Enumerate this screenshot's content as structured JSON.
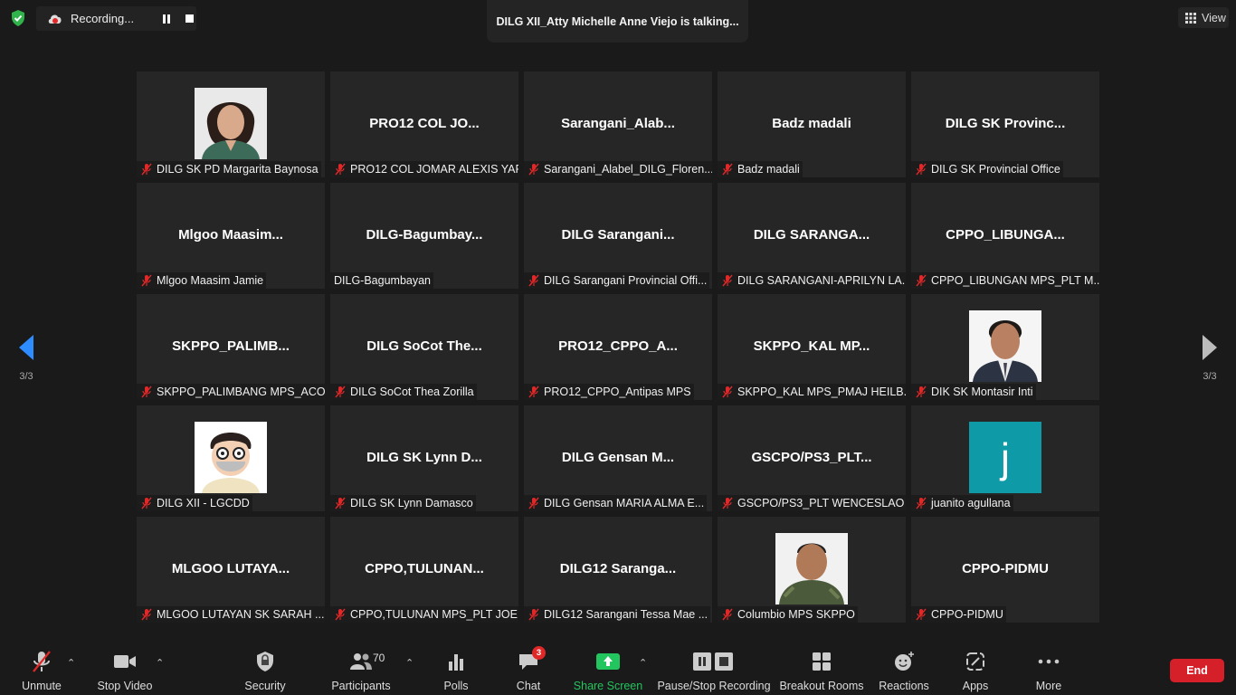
{
  "recording": {
    "label": "Recording..."
  },
  "speaker": {
    "text": "DILG XII_Atty Michelle Anne Viejo is talking..."
  },
  "view": {
    "label": "View"
  },
  "pages": {
    "left": "3/3",
    "right": "3/3"
  },
  "colors": {
    "share_green": "#22c55e",
    "end_red": "#d5202a",
    "mute_red": "#e02828",
    "tile_bg": "#262626"
  },
  "tiles": [
    {
      "big": "",
      "label": "DILG SK PD Margarita Baynosa",
      "muted": true,
      "avatar": "photo-woman"
    },
    {
      "big": "PRO12 COL JO...",
      "label": "PRO12 COL JOMAR ALEXIS YAP",
      "muted": true
    },
    {
      "big": "Sarangani_Alab...",
      "label": "Sarangani_Alabel_DILG_Floren...",
      "muted": true
    },
    {
      "big": "Badz madali",
      "label": "Badz madali",
      "muted": true
    },
    {
      "big": "DILG SK Provinc...",
      "label": "DILG SK Provincial Office",
      "muted": true
    },
    {
      "big": "Mlgoo Maasim...",
      "label": "Mlgoo Maasim Jamie",
      "muted": true
    },
    {
      "big": "DILG-Bagumbay...",
      "label": "DILG-Bagumbayan",
      "muted": false
    },
    {
      "big": "DILG Sarangani...",
      "label": "DILG Sarangani Provincial Offi...",
      "muted": true
    },
    {
      "big": "DILG SARANGA...",
      "label": "DILG SARANGANI-APRILYN LA...",
      "muted": true
    },
    {
      "big": "CPPO_LIBUNGA...",
      "label": "CPPO_LIBUNGAN MPS_PLT M...",
      "muted": true
    },
    {
      "big": "SKPPO_PALIMB...",
      "label": "SKPPO_PALIMBANG MPS_ACO...",
      "muted": true
    },
    {
      "big": "DILG SoCot The...",
      "label": "DILG SoCot Thea Zorilla",
      "muted": true
    },
    {
      "big": "PRO12_CPPO_A...",
      "label": "PRO12_CPPO_Antipas MPS",
      "muted": true
    },
    {
      "big": "SKPPO_KAL MP...",
      "label": "SKPPO_KAL MPS_PMAJ HEILB...",
      "muted": true
    },
    {
      "big": "",
      "label": "DIK SK Montasir Inti",
      "muted": true,
      "avatar": "photo-man-suit"
    },
    {
      "big": "",
      "label": "DILG XII - LGCDD",
      "muted": true,
      "avatar": "cartoon"
    },
    {
      "big": "DILG SK Lynn D...",
      "label": "DILG SK Lynn Damasco",
      "muted": true
    },
    {
      "big": "DILG Gensan M...",
      "label": "DILG Gensan MARIA ALMA E...",
      "muted": true
    },
    {
      "big": "GSCPO/PS3_PLT...",
      "label": "GSCPO/PS3_PLT WENCESLAO ...",
      "muted": true
    },
    {
      "big": "",
      "label": "juanito agullana",
      "muted": true,
      "avatar": "letter",
      "letter": "j"
    },
    {
      "big": "MLGOO LUTAYA...",
      "label": "MLGOO LUTAYAN SK SARAH ...",
      "muted": true
    },
    {
      "big": "CPPO,TULUNAN...",
      "label": "CPPO,TULUNAN MPS_PLT JOE...",
      "muted": true
    },
    {
      "big": "DILG12 Saranga...",
      "label": "DILG12 Sarangani Tessa Mae ...",
      "muted": true
    },
    {
      "big": "",
      "label": "Columbio MPS SKPPO",
      "muted": true,
      "avatar": "photo-man-uniform"
    },
    {
      "big": "CPPO-PIDMU",
      "label": "CPPO-PIDMU",
      "muted": true
    }
  ],
  "toolbar": {
    "unmute": "Unmute",
    "stop_video": "Stop Video",
    "security": "Security",
    "participants": "Participants",
    "participants_count": "70",
    "polls": "Polls",
    "chat": "Chat",
    "chat_badge": "3",
    "share_screen": "Share Screen",
    "pause_stop_recording": "Pause/Stop Recording",
    "breakout_rooms": "Breakout Rooms",
    "reactions": "Reactions",
    "apps": "Apps",
    "more": "More",
    "end": "End"
  }
}
